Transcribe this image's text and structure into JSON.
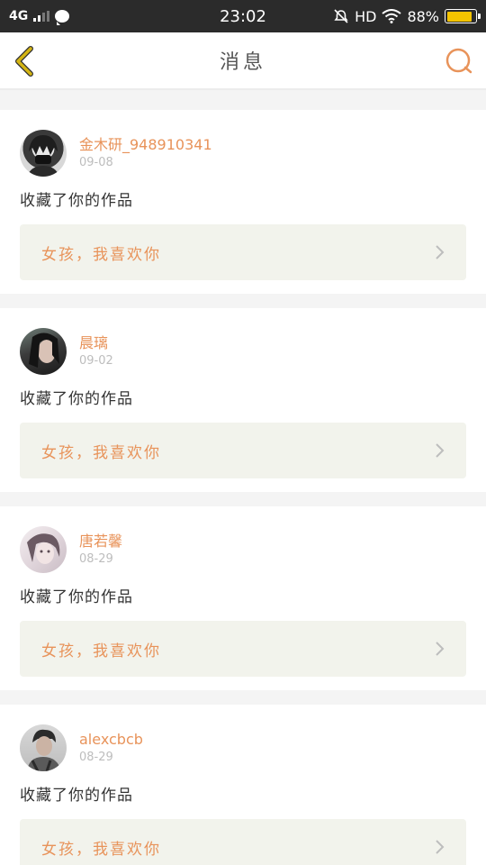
{
  "status_bar": {
    "network": "4G",
    "time": "23:02",
    "hd": "HD",
    "battery": "88%"
  },
  "header": {
    "title": "消息",
    "back_icon": "chevron-left-icon",
    "search_icon": "search-icon"
  },
  "colors": {
    "accent": "#e8935a",
    "back_icon": "#d4b514",
    "battery_fill": "#f5c400"
  },
  "messages": [
    {
      "username": "金木研_948910341",
      "date": "09-08",
      "action": "收藏了你的作品",
      "work_title": "女孩，我喜欢你"
    },
    {
      "username": "晨璃",
      "date": "09-02",
      "action": "收藏了你的作品",
      "work_title": "女孩，我喜欢你"
    },
    {
      "username": "唐若馨",
      "date": "08-29",
      "action": "收藏了你的作品",
      "work_title": "女孩，我喜欢你"
    },
    {
      "username": "alexcbcb",
      "date": "08-29",
      "action": "收藏了你的作品",
      "work_title": "女孩，我喜欢你"
    }
  ]
}
